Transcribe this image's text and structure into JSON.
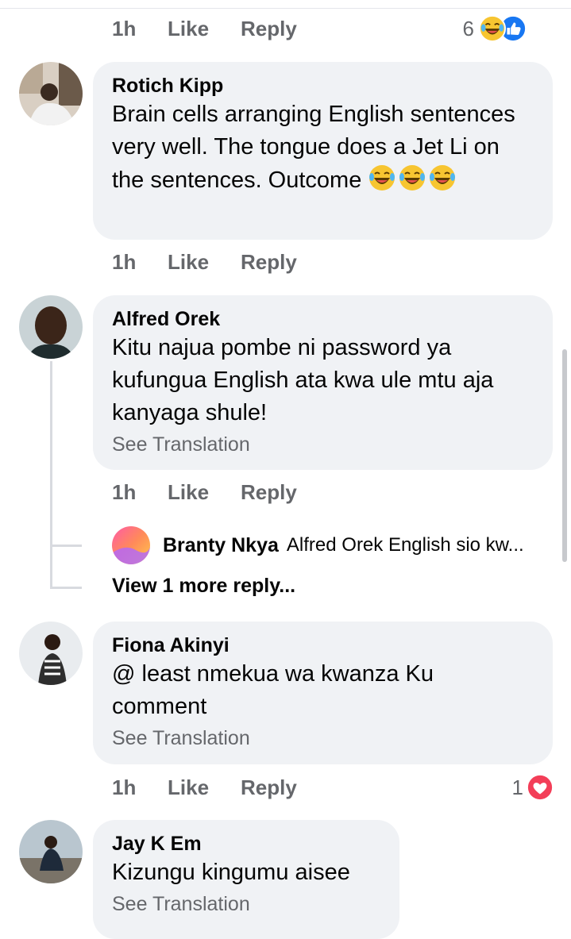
{
  "comments": [
    {
      "time": "1h",
      "like": "Like",
      "reply": "Reply",
      "reaction_count": "6",
      "reaction_icons": [
        "laugh-cry-icon",
        "like-icon"
      ]
    },
    {
      "author": "Rotich Kipp",
      "text": "Brain cells arranging English sentences very well. The tongue does a Jet Li on the sentences. Outcome",
      "emojis": [
        "laugh-cry-icon",
        "laugh-cry-icon",
        "laugh-cry-icon"
      ],
      "time": "1h",
      "like": "Like",
      "reply": "Reply"
    },
    {
      "author": "Alfred Orek",
      "text": "Kitu najua pombe ni password ya kufungua English ata kwa ule mtu aja kanyaga shule!",
      "see_translation": "See Translation",
      "time": "1h",
      "like": "Like",
      "reply": "Reply",
      "reply_preview": {
        "author": "Branty Nkya",
        "text": "Alfred Orek English sio kw..."
      },
      "more_replies": "View 1 more reply..."
    },
    {
      "author": "Fiona Akinyi",
      "text": "@ least nmekua wa kwanza Ku comment",
      "see_translation": "See Translation",
      "time": "1h",
      "like": "Like",
      "reply": "Reply",
      "reaction_count": "1",
      "reaction_icons": [
        "heart-icon"
      ]
    },
    {
      "author": "Jay K Em",
      "text": "Kizungu kingumu aisee",
      "see_translation": "See Translation"
    }
  ],
  "colors": {
    "bubble": "#f0f2f5",
    "meta_text": "#65676b",
    "like_blue": "#1877f2",
    "heart_red": "#f33e58",
    "emoji_yellow": "#f7c531"
  }
}
